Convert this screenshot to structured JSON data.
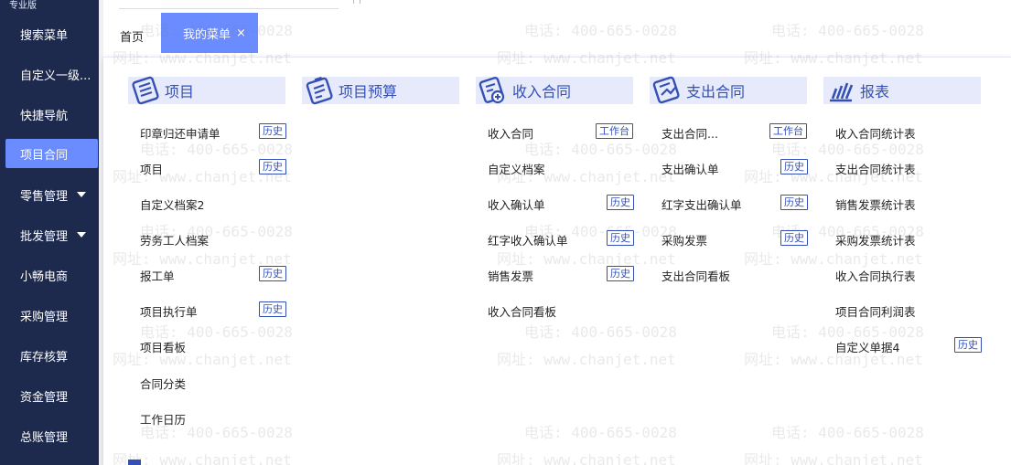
{
  "sidebar": {
    "edition": "专业版",
    "items": [
      {
        "label": "搜索菜单"
      },
      {
        "label": "自定义一级..."
      },
      {
        "label": "快捷导航"
      },
      {
        "label": "项目合同"
      },
      {
        "label": "零售管理"
      },
      {
        "label": "批发管理"
      },
      {
        "label": "小畅电商"
      },
      {
        "label": "采购管理"
      },
      {
        "label": "库存核算"
      },
      {
        "label": "资金管理"
      },
      {
        "label": "总账管理"
      }
    ]
  },
  "tabs": {
    "home": "首页",
    "active": "我的菜单",
    "close": "×"
  },
  "columns": [
    {
      "title": "项目",
      "items": [
        {
          "label": "印章归还申请单",
          "tag": "历史"
        },
        {
          "label": "项目",
          "tag": "历史"
        },
        {
          "label": "自定义档案2"
        },
        {
          "label": "劳务工人档案"
        },
        {
          "label": "报工单",
          "tag": "历史"
        },
        {
          "label": "项目执行单",
          "tag": "历史"
        },
        {
          "label": "项目看板"
        },
        {
          "label": "合同分类"
        },
        {
          "label": "工作日历"
        }
      ]
    },
    {
      "title": "项目预算",
      "items": []
    },
    {
      "title": "收入合同",
      "items": [
        {
          "label": "收入合同",
          "tag": "工作台"
        },
        {
          "label": "自定义档案"
        },
        {
          "label": "收入确认单",
          "tag": "历史"
        },
        {
          "label": "红字收入确认单",
          "tag": "历史"
        },
        {
          "label": "销售发票",
          "tag": "历史"
        },
        {
          "label": "收入合同看板"
        }
      ]
    },
    {
      "title": "支出合同",
      "items": [
        {
          "label": "支出合同...",
          "tag": "工作台"
        },
        {
          "label": "支出确认单",
          "tag": "历史"
        },
        {
          "label": "红字支出确认单",
          "tag": "历史"
        },
        {
          "label": "采购发票",
          "tag": "历史"
        },
        {
          "label": "支出合同看板"
        }
      ]
    },
    {
      "title": "报表",
      "items": [
        {
          "label": "收入合同统计表"
        },
        {
          "label": "支出合同统计表"
        },
        {
          "label": "销售发票统计表"
        },
        {
          "label": "采购发票统计表"
        },
        {
          "label": "收入合同执行表"
        },
        {
          "label": "项目合同利润表"
        },
        {
          "label": "自定义单据4",
          "tag": "历史"
        }
      ]
    }
  ],
  "watermark": {
    "phone": "电话: 400-665-0028",
    "site": "网址: www.chanjet.net"
  },
  "colors": {
    "sidebar_bg": "#1d2a4d",
    "accent": "#6a8cff",
    "header_bg": "#e6eafa",
    "link_blue": "#3550b4"
  },
  "icons": [
    "list-icon",
    "budget-icon",
    "income-contract-icon",
    "expense-contract-icon",
    "report-icon",
    "caret-down-icon",
    "close-icon"
  ]
}
